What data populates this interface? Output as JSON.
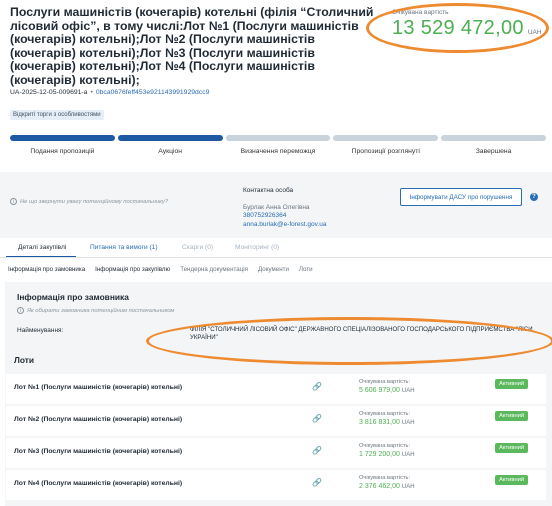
{
  "tender": {
    "title": "Послуги машиністів (кочегарів) котельні (філія “Столичний лісовий офіс”, в тому числі:Лот №1 (Послуги машиністів (кочегарів) котельні);Лот №2 (Послуги машиністів (кочегарів) котельні);Лот №3 (Послуги машиністів (кочегарів) котельні);Лот №4 (Послуги машиністів (кочегарів) котельні);",
    "expected_label": "Очікувана вартість",
    "expected_value": "13 529 472,00",
    "currency": "UAH",
    "id": "UA-2025-12-05-009691-a",
    "id_separator": "•",
    "hash": "0bca0676feff453e921143991929dcc9",
    "tag": "Відкриті торги з особливостями"
  },
  "stages": {
    "items": [
      {
        "label": "Подання пропозицій",
        "active": true
      },
      {
        "label": "Аукціон",
        "active": true
      },
      {
        "label": "Визначення переможця",
        "active": false
      },
      {
        "label": "Пропозиції розглянуті",
        "active": false
      },
      {
        "label": "Завершена",
        "active": false
      }
    ]
  },
  "contact": {
    "warning": "Не що звернути увагу потенційному постачальнику?",
    "heading": "Контактна особа",
    "name": "Бурлак Анна Олегівна",
    "phone": "380752926364",
    "email": "anna.burlak@e-forest.gov.ua",
    "report_button": "Інформувати ДАСУ про порушення",
    "help_glyph": "?"
  },
  "tabs": {
    "details": "Деталі закупівлі",
    "questions": "Питання та вимоги (1)",
    "complaints": "Скарги (0)",
    "monitoring": "Моніторинг (0)"
  },
  "subtabs": {
    "items": [
      "Інформація про замовника",
      "Інформація про закупівлю",
      "Тендерна документація",
      "Документи",
      "Лоти"
    ]
  },
  "customer": {
    "heading": "Інформація про замовника",
    "warning": "Як обирати замовника потенційним постачальником",
    "name_label": "Найменування:",
    "name_value": "ФІЛІЯ \"СТОЛИЧНИЙ ЛІСОВИЙ ОФІС\" ДЕРЖАВНОГО СПЕЦІАЛІЗОВАНОГО ГОСПОДАРСЬКОГО ПІДПРИЄМСТВА \"ЛІСИ УКРАЇНИ\""
  },
  "lots": {
    "heading": "Лоти",
    "expected_label": "Очікувана вартість:",
    "currency": "UAH",
    "status": "Активний",
    "link_icon": "link-icon",
    "items": [
      {
        "name": "Лот №1 (Послуги машиністів (кочегарів) котельні)",
        "value": "5 606 979,00"
      },
      {
        "name": "Лот №2 (Послуги машиністів (кочегарів) котельні)",
        "value": "3 816 831,00"
      },
      {
        "name": "Лот №3 (Послуги машиністів (кочегарів) котельні)",
        "value": "1 729 200,00"
      },
      {
        "name": "Лот №4 (Послуги машиністів (кочегарів) котельні)",
        "value": "2 376 462,00"
      }
    ]
  },
  "colors": {
    "accent": "#1e5aa3",
    "link": "#2a6db5",
    "money": "#4caf50",
    "status": "#5cb85c",
    "highlight": "#ee8a2f"
  }
}
